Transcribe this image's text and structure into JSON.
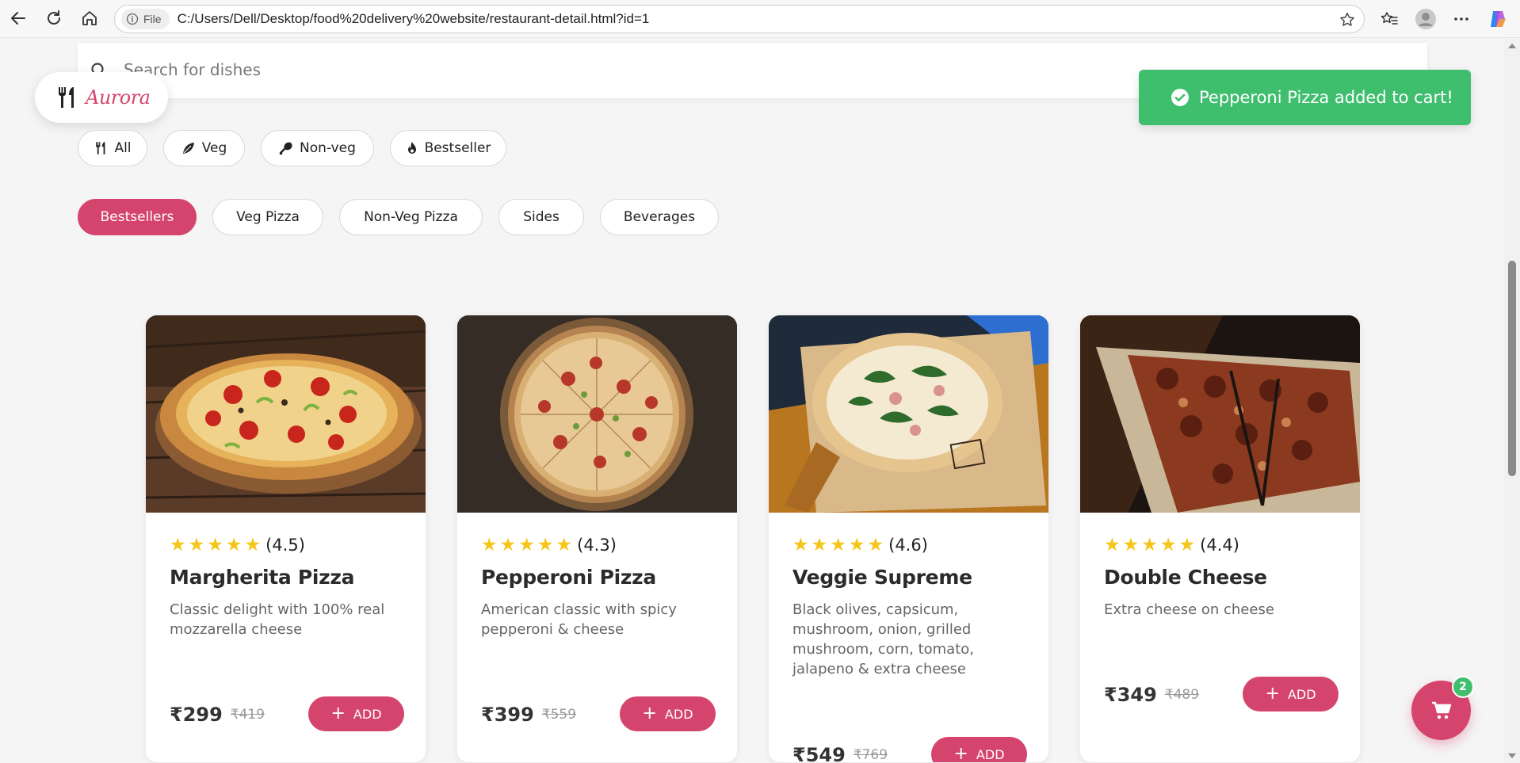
{
  "browser": {
    "file_label": "File",
    "url": "C:/Users/Dell/Desktop/food%20delivery%20website/restaurant-detail.html?id=1"
  },
  "search": {
    "placeholder": "Search for dishes"
  },
  "brand": {
    "name": "Aurora"
  },
  "toast": {
    "message": "Pepperoni Pizza added to cart!"
  },
  "filters": [
    {
      "label": "All",
      "icon": "utensils-icon"
    },
    {
      "label": "Veg",
      "icon": "leaf-icon"
    },
    {
      "label": "Non-veg",
      "icon": "drumstick-icon"
    },
    {
      "label": "Bestseller",
      "icon": "fire-icon"
    }
  ],
  "categories": [
    {
      "label": "Bestsellers",
      "active": true
    },
    {
      "label": "Veg Pizza",
      "active": false
    },
    {
      "label": "Non-Veg Pizza",
      "active": false
    },
    {
      "label": "Sides",
      "active": false
    },
    {
      "label": "Beverages",
      "active": false
    }
  ],
  "dishes": [
    {
      "name": "Margherita Pizza",
      "rating_text": "(4.5)",
      "rating": 4.5,
      "description": "Classic delight with 100% real mozzarella cheese",
      "price": "₹299",
      "old_price": "₹419",
      "add_label": "ADD"
    },
    {
      "name": "Pepperoni Pizza",
      "rating_text": "(4.3)",
      "rating": 4.3,
      "description": "American classic with spicy pepperoni & cheese",
      "price": "₹399",
      "old_price": "₹559",
      "add_label": "ADD"
    },
    {
      "name": "Veggie Supreme",
      "rating_text": "(4.6)",
      "rating": 4.6,
      "description": "Black olives, capsicum, mushroom, onion, grilled mushroom, corn, tomato, jalapeno & extra cheese",
      "price": "₹549",
      "old_price": "₹769",
      "add_label": "ADD"
    },
    {
      "name": "Double Cheese",
      "rating_text": "(4.4)",
      "rating": 4.4,
      "description": "Extra cheese on cheese",
      "price": "₹349",
      "old_price": "₹489",
      "add_label": "ADD"
    }
  ],
  "cart": {
    "count": "2"
  },
  "colors": {
    "accent": "#d5446d",
    "success": "#3fbf6e",
    "star": "#f5c518"
  }
}
